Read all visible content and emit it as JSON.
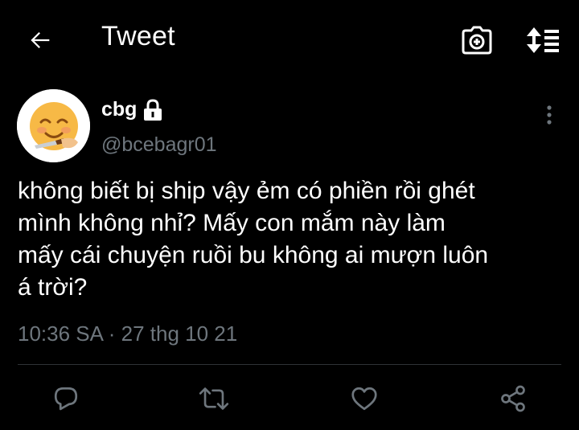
{
  "header": {
    "title": "Tweet",
    "back_icon": "arrow-left-icon",
    "camera_icon": "camera-plus-icon",
    "sort_icon": "sort-arrows-icon"
  },
  "tweet": {
    "display_name": "cbg",
    "handle": "@bcebagr01",
    "protected_icon": "lock-icon",
    "avatar_icon": "smiling-face-with-knife-emoji",
    "text": "không biết bị ship vậy ẻm có phiền rồi ghét\nmình không nhỉ? Mấy con mắm này làm\nmấy cái chuyện ruồi bu không ai mượn luôn\ná trời?",
    "timestamp": "10:36 SA · 27 thg 10 21"
  },
  "actions": {
    "reply_icon": "reply-icon",
    "retweet_icon": "retweet-icon",
    "like_icon": "heart-icon",
    "share_icon": "share-icon"
  },
  "colors": {
    "background": "#000000",
    "primary_text": "#ffffff",
    "secondary_text": "#6e767d",
    "divider": "#2f3336"
  }
}
